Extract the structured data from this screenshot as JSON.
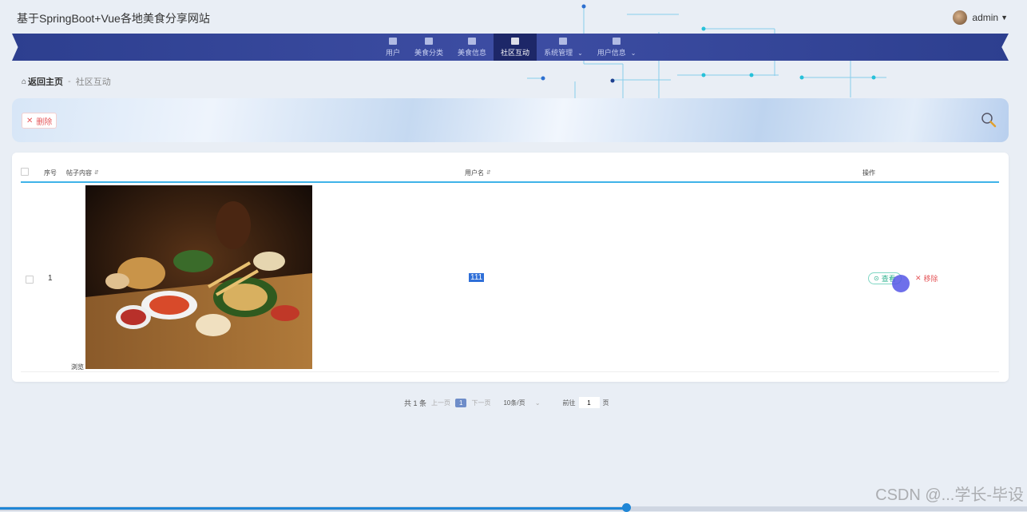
{
  "header": {
    "site_title": "基于SpringBoot+Vue各地美食分享网站",
    "username": "admin"
  },
  "nav": {
    "items": [
      {
        "label": "用户",
        "icon": "monitor-icon"
      },
      {
        "label": "美食分类",
        "icon": "printer-icon"
      },
      {
        "label": "美食信息",
        "icon": "clipboard-icon"
      },
      {
        "label": "社区互动",
        "icon": "ticket-icon",
        "active": true
      },
      {
        "label": "系统管理",
        "icon": "grid-icon",
        "has_submenu": true
      },
      {
        "label": "用户信息",
        "icon": "card-icon",
        "has_submenu": true
      }
    ]
  },
  "breadcrumb": {
    "home": "返回主页",
    "separator": "-",
    "current": "社区互动"
  },
  "toolbar": {
    "delete_label": "删除"
  },
  "table": {
    "headers": {
      "index": "序号",
      "content": "帖子内容",
      "username": "用户名",
      "actions": "操作"
    },
    "rows": [
      {
        "index": "1",
        "image_caption": "浏览",
        "username": "111",
        "view_label": "查看",
        "remove_label": "移除"
      }
    ]
  },
  "pagination": {
    "total": "共 1 条",
    "prev": "上一页",
    "current_page": "1",
    "next": "下一页",
    "page_size": "10条/页",
    "goto_prefix": "前往",
    "goto_value": "1",
    "goto_suffix": "页"
  },
  "watermark": "CSDN @...学长-毕设",
  "video_progress": 0.61,
  "colors": {
    "nav_bg": "#2d3f8f",
    "nav_active": "#1d2768",
    "table_header_line": "#3fb3e8",
    "danger": "#e5575a",
    "success": "#2bb08c",
    "highlight": "#2f6fd8"
  }
}
